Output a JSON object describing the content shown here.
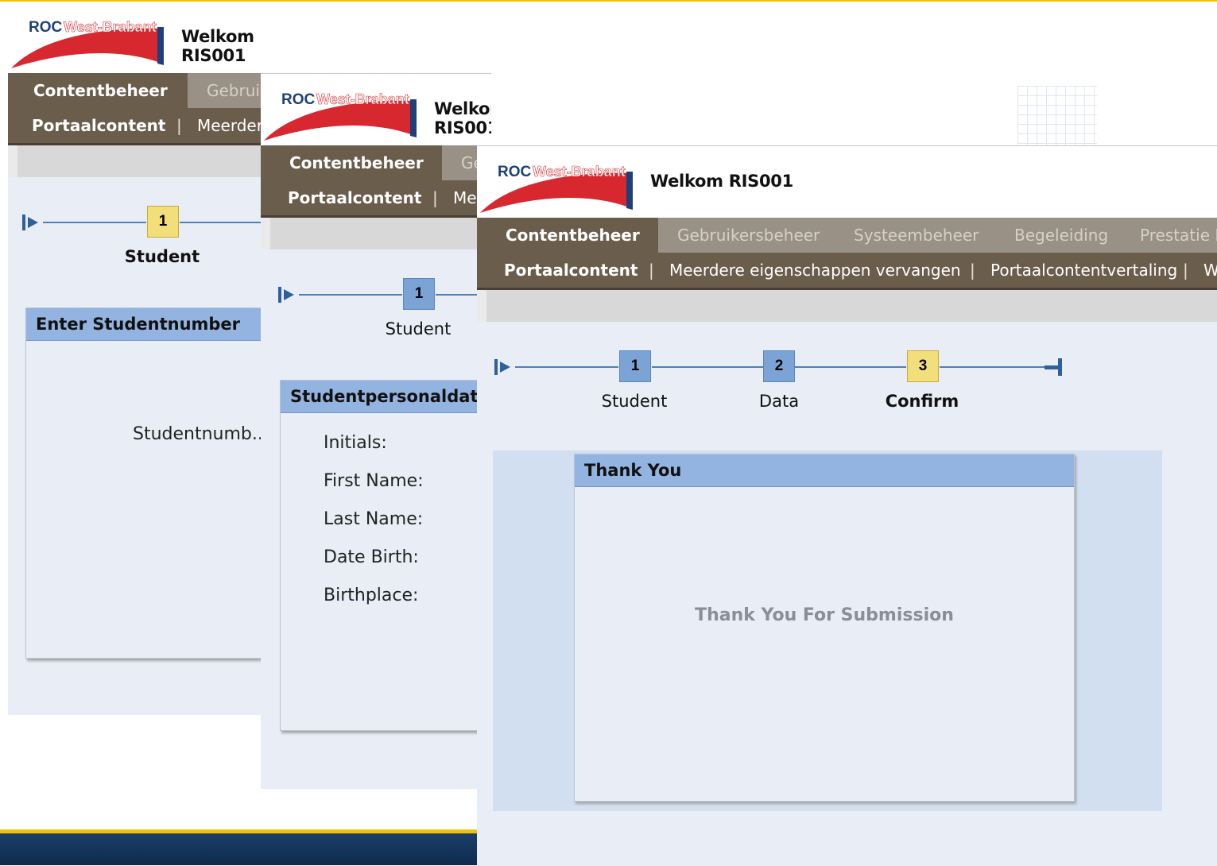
{
  "brand": {
    "logo_roc": "ROC",
    "logo_name": "West-Brabant",
    "colors": {
      "red": "#d7282f",
      "navy": "#1d3f7a",
      "nav_brown": "#6b5d4c",
      "panel_header": "#93b3e0",
      "current_step": "#f3df7a",
      "done_step": "#7ba3d6"
    }
  },
  "header": {
    "welcome": "Welkom RIS001"
  },
  "nav": {
    "primary": [
      "Contentbeheer",
      "Gebruikersbeheer",
      "Systeembeheer",
      "Begeleiding",
      "Prestatie F"
    ],
    "primary_cut_w1": "Gebrui",
    "primary_cut_w2": "Ge",
    "secondary": [
      "Portaalcontent",
      "Meerdere eigenschappen vervangen",
      "Portaalcontentvertaling",
      "W"
    ],
    "secondary_cut_w1": "Meerder",
    "secondary_cut_w2": "Me",
    "separator": "|"
  },
  "windows": {
    "w1": {
      "steps": [
        {
          "num": "1",
          "label": "Student",
          "state": "current"
        }
      ],
      "panel_title": "Enter Studentnumber",
      "fields": [
        "Studentnumb.."
      ]
    },
    "w2": {
      "steps": [
        {
          "num": "1",
          "label": "Student",
          "state": "done"
        }
      ],
      "panel_title": "Studentpersonaldata",
      "fields": [
        "Initials:",
        "First Name:",
        "Last Name:",
        "Date Birth:",
        "Birthplace:"
      ]
    },
    "w3": {
      "steps": [
        {
          "num": "1",
          "label": "Student",
          "state": "done"
        },
        {
          "num": "2",
          "label": "Data",
          "state": "done"
        },
        {
          "num": "3",
          "label": "Confirm",
          "state": "current"
        }
      ],
      "panel_title": "Thank You",
      "message": "Thank You For Submission"
    }
  },
  "icons": [
    "roadmap-start-icon",
    "roadmap-end-icon"
  ]
}
